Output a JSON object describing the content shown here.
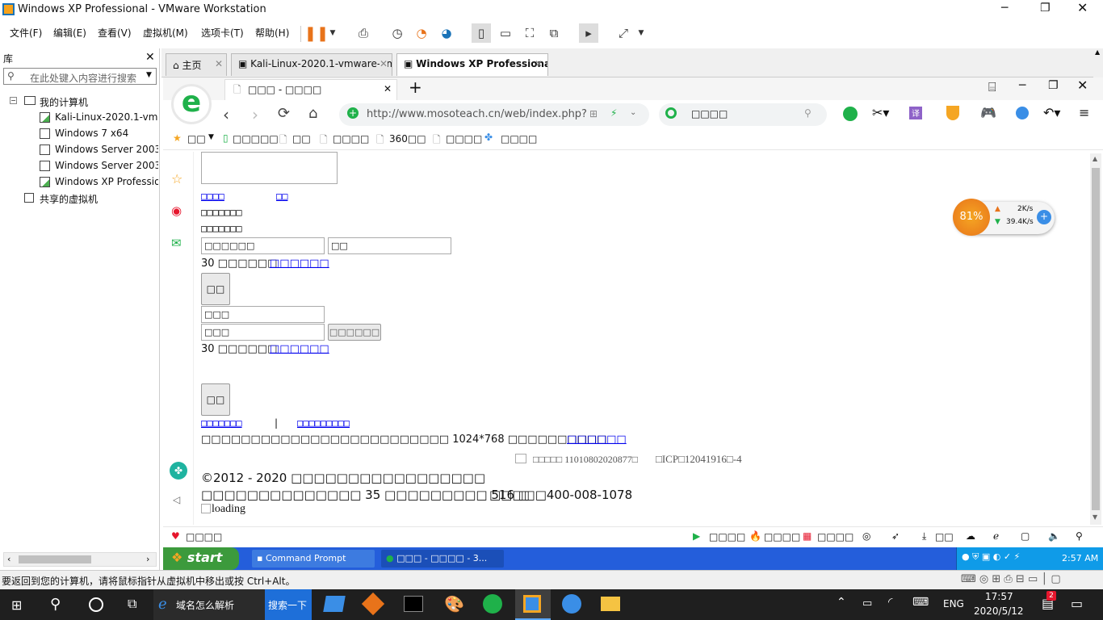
{
  "window": {
    "title": "Windows XP Professional - VMware Workstation"
  },
  "menu": [
    "文件(F)",
    "编辑(E)",
    "查看(V)",
    "虚拟机(M)",
    "选项卡(T)",
    "帮助(H)"
  ],
  "library": {
    "title": "库",
    "search_placeholder": "在此处键入内容进行搜索",
    "root": "我的计算机",
    "items": [
      "Kali-Linux-2020.1-vmw",
      "Windows 7 x64",
      "Windows Server 2003",
      "Windows Server 2003",
      "Windows XP Professio"
    ],
    "shared": "共享的虚拟机"
  },
  "vm_tabs": [
    "主页",
    "Kali-Linux-2020.1-vmware-am...",
    "Windows XP Professional"
  ],
  "browser": {
    "tab_title": "□□□ - □□□□",
    "url": "http://www.mosoteach.cn/web/index.php?",
    "search_text": "□□□□",
    "bookmarks": [
      "□□",
      "□□□□□",
      "□□",
      "□□□□",
      "360□□",
      "□□□□",
      "□□□□"
    ],
    "net": {
      "percent": "81%",
      "up": "2K/s",
      "down": "39.4K/s"
    },
    "page": {
      "links1": [
        "□□□□",
        "□□"
      ],
      "line1": "□□□□□□□",
      "line2": "□□□□□□□",
      "input1": "□□□□□□",
      "input2": "□□",
      "remember1": "30 □□□□□□",
      "forgot1": "□□□□□□",
      "btn1": "□□",
      "input3": "□□□",
      "input4": "□□□",
      "sms_btn": "□□□□□□",
      "remember2": "30 □□□□□□",
      "forgot2": "□□□□□□",
      "btn2": "□□",
      "link_a": "□□□□□□□",
      "sep": "|",
      "link_b": "□□□□□□□□□",
      "resolution": "□□□□□□□□□□□□□□□□□□□□□□□□□ 1024*768 □□□□□□□□□□",
      "resolution_link": "□□□□□□",
      "beian": "□□□□□ 11010802020877□",
      "icp": "□ICP□12041916□-4",
      "copyright": "©2012 - 2020 □□□□□□□□□□□□□□□□□",
      "address": "□□□□□□□□□□□□□□ 35 □□□□□□□□□ 516 □",
      "phone": "□□□□□400-008-1078",
      "loading": "loading"
    },
    "statusbar": {
      "left": "□□□□",
      "items": [
        "□□□□",
        "□□□□",
        "□□□□",
        "□□"
      ]
    }
  },
  "xp_taskbar": {
    "start": "start",
    "tasks": [
      "Command Prompt",
      "□□□ - □□□□ - 3..."
    ],
    "clock": "2:57 AM"
  },
  "vmware_status": "要返回到您的计算机，请将鼠标指针从虚拟机中移出或按 Ctrl+Alt。",
  "win_taskbar": {
    "search_app": "域名怎么解析",
    "search_btn": "搜索一下",
    "lang": "ENG",
    "time": "17:57",
    "date": "2020/5/12",
    "notif_count": "2"
  }
}
